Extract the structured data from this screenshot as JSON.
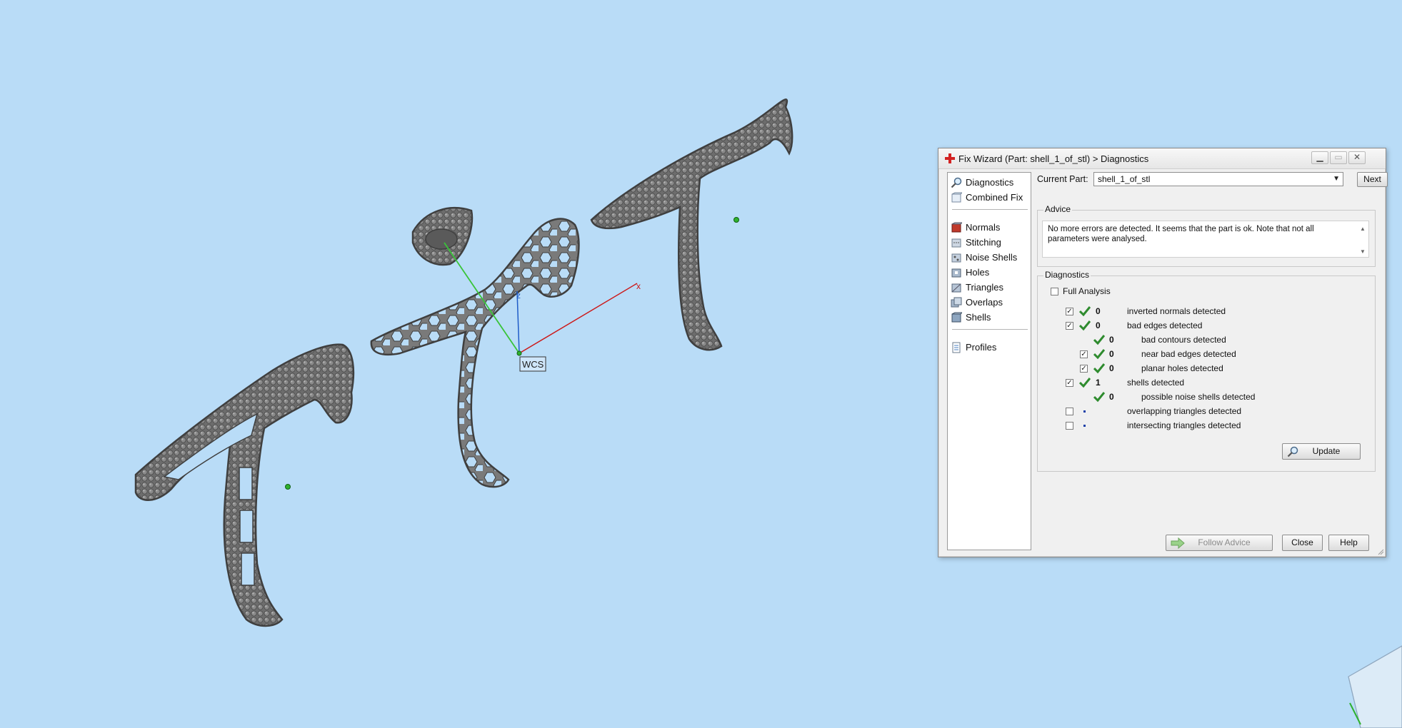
{
  "viewport": {
    "wcs_label": "WCS",
    "axis_x_label": "x",
    "axis_z_label": "z"
  },
  "dialog": {
    "title": "Fix Wizard (Part: shell_1_of_stl) > Diagnostics",
    "nav": {
      "items": [
        {
          "label": "Diagnostics",
          "icon": "magnifier-icon"
        },
        {
          "label": "Combined Fix",
          "icon": "combined-fix-icon"
        },
        {
          "label": "Normals",
          "icon": "normals-icon"
        },
        {
          "label": "Stitching",
          "icon": "stitching-icon"
        },
        {
          "label": "Noise Shells",
          "icon": "noise-shells-icon"
        },
        {
          "label": "Holes",
          "icon": "holes-icon"
        },
        {
          "label": "Triangles",
          "icon": "triangles-icon"
        },
        {
          "label": "Overlaps",
          "icon": "overlaps-icon"
        },
        {
          "label": "Shells",
          "icon": "shells-icon"
        },
        {
          "label": "Profiles",
          "icon": "profiles-icon"
        }
      ]
    },
    "current_part": {
      "label": "Current Part:",
      "value": "shell_1_of_stl",
      "next_label": "Next"
    },
    "advice": {
      "title": "Advice",
      "text": "No more errors are detected. It seems that the part is ok. Note that not all parameters were analysed."
    },
    "diagnostics": {
      "title": "Diagnostics",
      "full_analysis_label": "Full Analysis",
      "rows": [
        {
          "count": "0",
          "text": "inverted normals detected",
          "checked": true,
          "status": "ok"
        },
        {
          "count": "0",
          "text": "bad edges detected",
          "checked": true,
          "status": "ok"
        },
        {
          "count": "0",
          "text": "bad contours detected",
          "checked": null,
          "status": "ok"
        },
        {
          "count": "0",
          "text": "near bad edges detected",
          "checked": true,
          "status": "ok"
        },
        {
          "count": "0",
          "text": "planar holes detected",
          "checked": true,
          "status": "ok"
        },
        {
          "count": "1",
          "text": "shells detected",
          "checked": true,
          "status": "ok"
        },
        {
          "count": "0",
          "text": "possible noise shells detected",
          "checked": null,
          "status": "ok"
        },
        {
          "count": "",
          "text": "overlapping triangles detected",
          "checked": false,
          "status": "pending"
        },
        {
          "count": "",
          "text": "intersecting triangles detected",
          "checked": false,
          "status": "pending"
        }
      ],
      "update_label": "Update"
    },
    "buttons": {
      "follow_advice": "Follow Advice",
      "close": "Close",
      "help": "Help"
    },
    "colors": {
      "check_green": "#2e8b2e",
      "title_icon_red": "#d32222"
    }
  }
}
